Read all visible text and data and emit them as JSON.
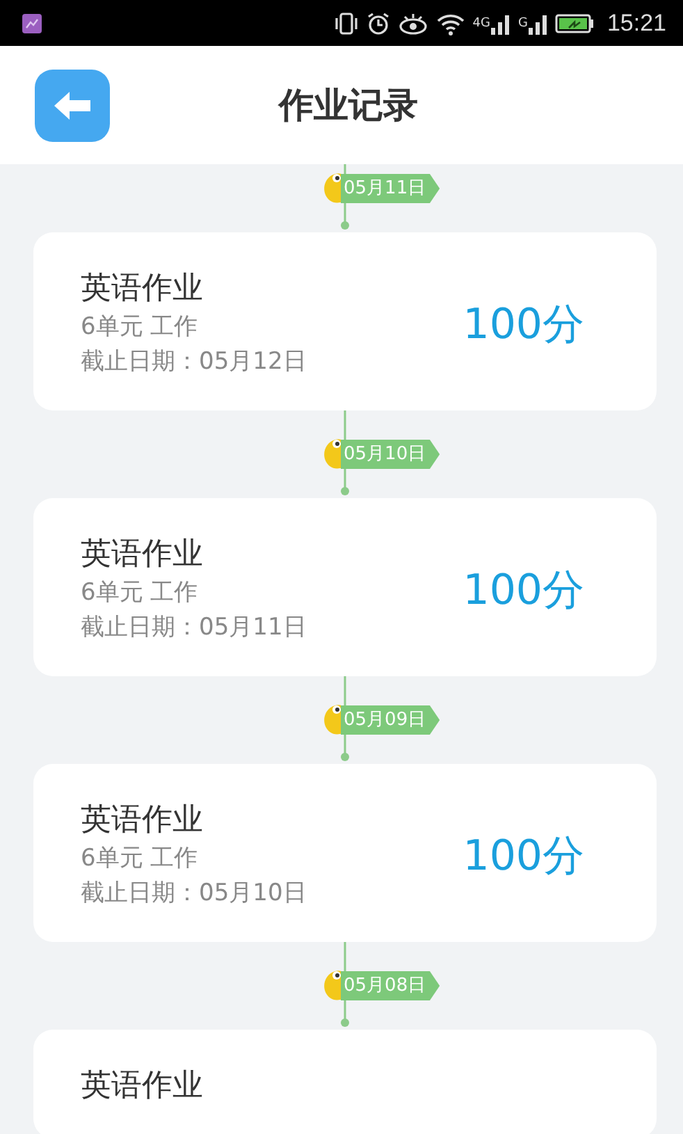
{
  "status_bar": {
    "network_labels": [
      "4G",
      "G"
    ],
    "time": "15:21"
  },
  "header": {
    "title": "作业记录"
  },
  "records": [
    {
      "date": "05月11日",
      "title": "英语作业",
      "unit": "6单元 工作",
      "deadline": "截止日期：05月12日",
      "score": "100分"
    },
    {
      "date": "05月10日",
      "title": "英语作业",
      "unit": "6单元 工作",
      "deadline": "截止日期：05月11日",
      "score": "100分"
    },
    {
      "date": "05月09日",
      "title": "英语作业",
      "unit": "6单元 工作",
      "deadline": "截止日期：05月10日",
      "score": "100分"
    },
    {
      "date": "05月08日",
      "title": "英语作业"
    }
  ]
}
